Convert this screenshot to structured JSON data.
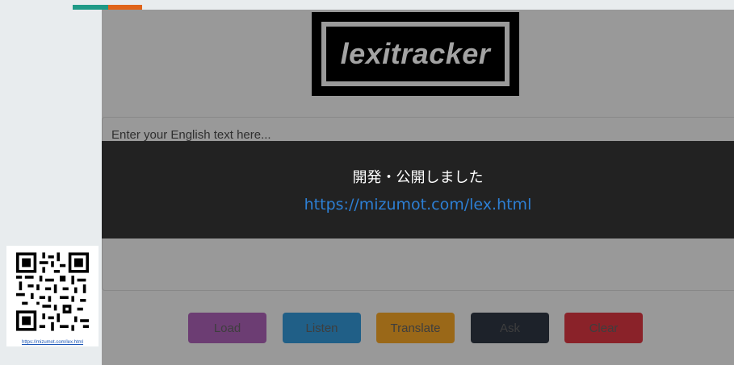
{
  "app": {
    "logo_text": "lexitracker",
    "text_area": {
      "placeholder": "Enter your English text here..."
    },
    "buttons": {
      "load": "Load",
      "listen": "Listen",
      "translate": "Translate",
      "ask": "Ask",
      "clear": "Clear"
    }
  },
  "banner": {
    "title": "開発・公開しました",
    "link": "https://mizumot.com/lex.html"
  },
  "qr": {
    "caption": "https://mizumot.com/lex.html"
  },
  "icons": [
    "qr-code-icon"
  ]
}
